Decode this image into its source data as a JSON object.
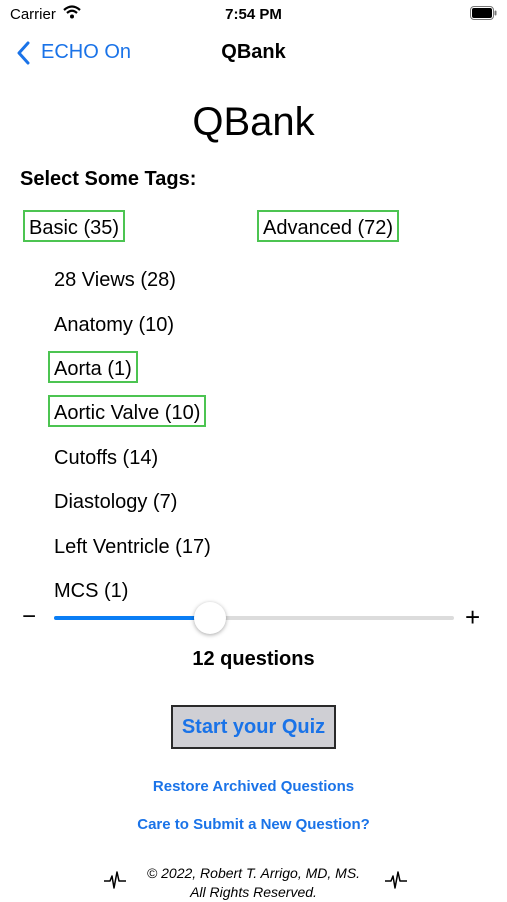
{
  "status_bar": {
    "carrier": "Carrier",
    "time": "7:54 PM"
  },
  "nav": {
    "back_label": "ECHO On",
    "title": "QBank"
  },
  "page": {
    "title": "QBank",
    "prompt": "Select Some Tags:"
  },
  "top_tags": [
    {
      "label": "Basic (35)",
      "selected": true
    },
    {
      "label": "Advanced (72)",
      "selected": true
    }
  ],
  "tag_list": [
    {
      "label": "28 Views (28)",
      "selected": false
    },
    {
      "label": "Anatomy (10)",
      "selected": false
    },
    {
      "label": "Aorta (1)",
      "selected": true
    },
    {
      "label": "Aortic Valve (10)",
      "selected": true
    },
    {
      "label": "Cutoffs (14)",
      "selected": false
    },
    {
      "label": "Diastology (7)",
      "selected": false
    },
    {
      "label": "Left Ventricle (17)",
      "selected": false
    },
    {
      "label": "MCS (1)",
      "selected": false
    }
  ],
  "slider": {
    "minus": "−",
    "plus": "+",
    "value_fraction": 0.39
  },
  "question_count": "12 questions",
  "start_button": "Start your Quiz",
  "links": {
    "restore": "Restore Archived Questions",
    "submit": "Care to Submit a New Question?"
  },
  "footer": {
    "line1": "© 2022, Robert T. Arrigo, MD, MS.",
    "line2": "All Rights Reserved.",
    "icon": "heartbeat-icon"
  },
  "colors": {
    "accent": "#1a73e8",
    "selected_border": "#4cc451",
    "slider_fill": "#0a7ef5"
  }
}
